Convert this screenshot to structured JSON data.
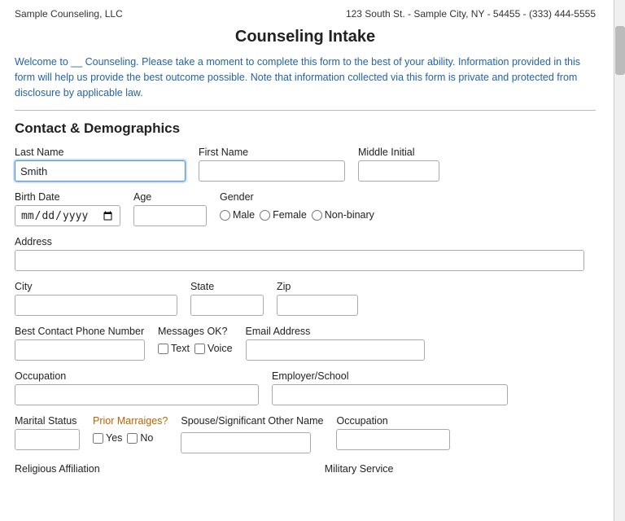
{
  "header": {
    "company": "Sample Counseling, LLC",
    "address": "123 South St. - Sample City, NY - 54455 - (333) 444-5555"
  },
  "page": {
    "title": "Counseling Intake",
    "intro": "Welcome to __ Counseling. Please take a moment to complete this form to the best of your ability. Information provided in this form will help us provide the best outcome possible. Note that information collected via this form is private and protected from disclosure by applicable law."
  },
  "sections": {
    "contact": {
      "title": "Contact & Demographics",
      "fields": {
        "last_name_label": "Last Name",
        "last_name_value": "Smith",
        "first_name_label": "First Name",
        "middle_initial_label": "Middle Initial",
        "birth_date_label": "Birth Date",
        "birth_date_placeholder": "mm/dd/yyyy",
        "age_label": "Age",
        "gender_label": "Gender",
        "gender_male": "Male",
        "gender_female": "Female",
        "gender_nonbinary": "Non-binary",
        "address_label": "Address",
        "city_label": "City",
        "state_label": "State",
        "zip_label": "Zip",
        "phone_label": "Best Contact Phone Number",
        "messages_label": "Messages OK?",
        "messages_text": "Text",
        "messages_voice": "Voice",
        "email_label": "Email Address",
        "occupation_label": "Occupation",
        "employer_label": "Employer/School",
        "marital_label": "Marital Status",
        "prior_label": "Prior Marraiges?",
        "prior_yes": "Yes",
        "prior_no": "No",
        "spouse_label": "Spouse/Significant Other Name",
        "spouse_occ_label": "Occupation",
        "religious_label": "Religious Affiliation",
        "military_label": "Military Service"
      }
    }
  }
}
